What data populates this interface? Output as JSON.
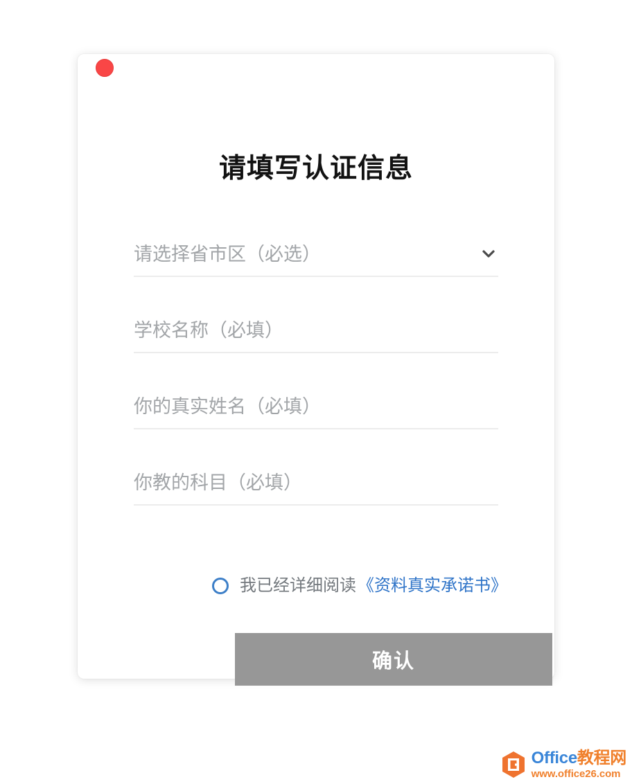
{
  "window": {
    "close_button_name": "close",
    "accent_red": "#f94646"
  },
  "dialog": {
    "title": "请填写认证信息",
    "fields": [
      {
        "name": "region",
        "placeholder": "请选择省市区（必选）",
        "value": "",
        "type": "select",
        "icon": "chevron-down-icon"
      },
      {
        "name": "school",
        "placeholder": "学校名称（必填）",
        "value": "",
        "type": "text"
      },
      {
        "name": "realname",
        "placeholder": "你的真实姓名（必填）",
        "value": "",
        "type": "text"
      },
      {
        "name": "subject",
        "placeholder": "你教的科目（必填）",
        "value": "",
        "type": "text"
      }
    ],
    "agreement": {
      "checked": false,
      "text": "我已经详细阅读",
      "link_text": "《资料真实承诺书》",
      "link_color": "#2f74c8",
      "check_color": "#3d7fc8"
    },
    "submit": {
      "label": "确认",
      "background": "#979797",
      "text_color": "#ffffff",
      "enabled": false
    }
  },
  "watermark": {
    "brand_primary": "Office",
    "brand_secondary": "教程网",
    "url": "www.office26.com",
    "logo_icon": "office-hexagon-icon",
    "primary_color": "#2f7fd6",
    "secondary_color": "#f07a21"
  }
}
